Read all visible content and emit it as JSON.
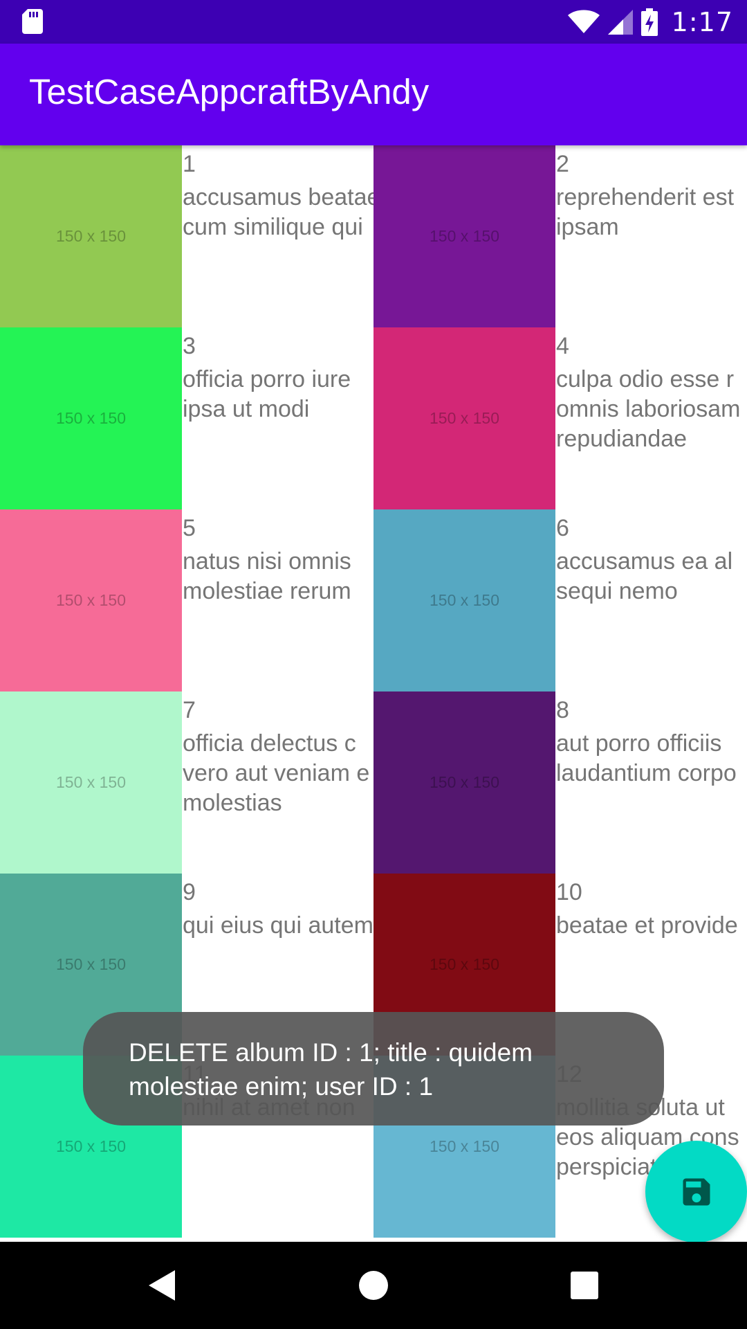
{
  "status_bar": {
    "time": "1:17",
    "icons": [
      "sd-card-icon",
      "wifi-icon",
      "signal-icon",
      "battery-charging-icon"
    ]
  },
  "app_bar": {
    "title": "TestCaseAppcraftByAndy"
  },
  "placeholder_label": "150 x 150",
  "albums": [
    {
      "id": "1",
      "title": "accusamus beatae\ncum similique qui",
      "color": "#92c952"
    },
    {
      "id": "2",
      "title": "reprehenderit est\nipsam",
      "color": "#771796"
    },
    {
      "id": "3",
      "title": "officia porro iure\nipsa ut modi",
      "color": "#24f355"
    },
    {
      "id": "4",
      "title": "culpa odio esse r\nomnis laboriosam\nrepudiandae",
      "color": "#d32776"
    },
    {
      "id": "5",
      "title": "natus nisi omnis\nmolestiae rerum",
      "color": "#f66b97"
    },
    {
      "id": "6",
      "title": "accusamus ea al\nsequi nemo",
      "color": "#56a8c2"
    },
    {
      "id": "7",
      "title": "officia delectus c\nvero aut veniam e\nmolestias",
      "color": "#b0f7cc"
    },
    {
      "id": "8",
      "title": "aut porro officiis\nlaudantium corpo",
      "color": "#54176f"
    },
    {
      "id": "9",
      "title": "qui eius qui autem",
      "color": "#51aa97"
    },
    {
      "id": "10",
      "title": "beatae et provide",
      "color": "#810b14"
    },
    {
      "id": "11",
      "title": "nihil at amet non",
      "color": "#1ee8a4"
    },
    {
      "id": "12",
      "title": "mollitia soluta ut\neos aliquam cons\nperspiciatis",
      "color": "#66b7d2"
    }
  ],
  "toast": {
    "message": "DELETE album ID : 1; title : quidem molestiae enim; user ID : 1"
  },
  "fab": {
    "icon": "save-icon",
    "color": "#03dac5"
  },
  "nav_bar": {
    "icons": [
      "back-icon",
      "home-icon",
      "recents-icon"
    ]
  }
}
